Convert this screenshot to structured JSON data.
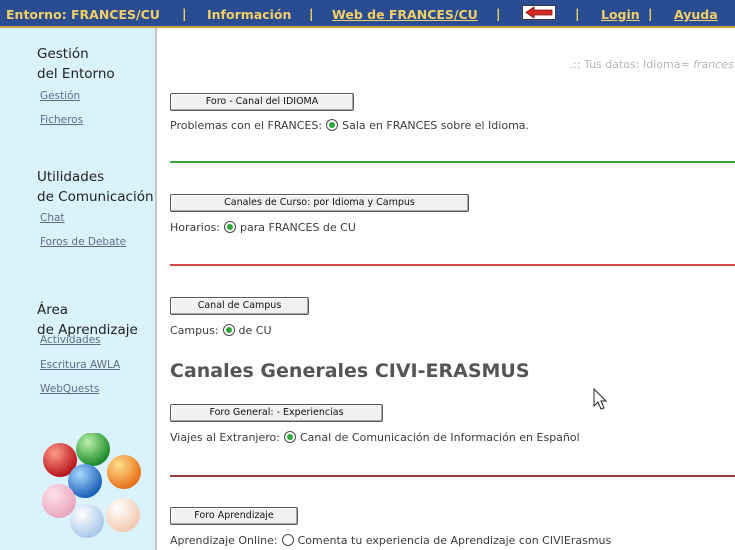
{
  "topbar": {
    "entorno": "Entorno: FRANCES/CU",
    "informacion": "Información",
    "web": "Web de FRANCES/CU",
    "login": "Login",
    "ayuda": "Ayuda",
    "separator": "|",
    "back_icon": "back-arrow-icon"
  },
  "sidebar": {
    "sections": [
      {
        "title_line1": "Gestión",
        "title_line2": "del Entorno",
        "links": [
          "Gestión",
          "Ficheros"
        ]
      },
      {
        "title_line1": "Utilidades",
        "title_line2": "de Comunicación",
        "links": [
          "Chat",
          "Foros de Debate"
        ]
      },
      {
        "title_line1": "Área",
        "title_line2": "de Aprendizaje",
        "links": [
          "Actividades",
          "Escritura AWLA",
          "WebQuests"
        ]
      }
    ],
    "logo_icon": "colored-spheres-logo"
  },
  "main": {
    "userinfo_prefix": ".:: Tus datos: Idioma= ",
    "userinfo_value": "frances C",
    "blocks": [
      {
        "button": "Foro - Canal del IDIOMA",
        "label": "Problemas con el FRANCES:",
        "option": "Sala en FRANCES sobre el Idioma.",
        "checked": true
      },
      {
        "button": "Canales de Curso: por Idioma y Campus",
        "label": "Horarios:",
        "option": "para FRANCES de CU",
        "checked": true
      },
      {
        "button": "Canal de  Campus",
        "label": "Campus:",
        "option": "de CU",
        "checked": true
      },
      {
        "button": "Foro General: - Experiencias",
        "label": "Viajes al Extranjero:",
        "option": "Canal de Comunicación de Información en Español",
        "checked": true
      },
      {
        "button": "Foro Aprendizaje",
        "label": "Aprendizaje Online:",
        "option": "Comenta tu experiencia de Aprendizaje con CIVIErasmus",
        "checked": false
      }
    ],
    "section_title": "Canales Generales CIVI-ERASMUS",
    "rule_colors": [
      "#3aa33a",
      "#d94a4a",
      "#9a3a3a"
    ]
  }
}
